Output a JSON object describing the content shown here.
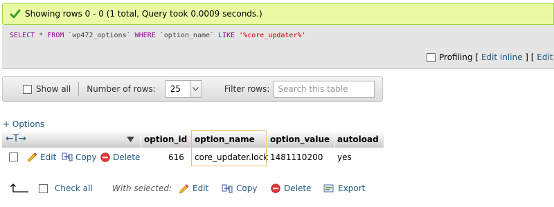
{
  "message": {
    "text": "Showing rows 0 - 0 (1 total, Query took 0.0009 seconds.)"
  },
  "sql": {
    "select": "SELECT",
    "star": " * ",
    "from": "FROM",
    "table": " `wp472_options` ",
    "where": "WHERE",
    "column": " `option_name` ",
    "like": "LIKE",
    "pattern": " '%core_updater%'",
    "profiling_label": "Profiling",
    "bracket_open": " [ ",
    "edit_inline": "Edit inline",
    "bracket_mid": " ] [ ",
    "edit": "Edit",
    "bracket_tail": " ] ["
  },
  "nav": {
    "show_all": "Show all",
    "number_of_rows_label": "Number of rows:",
    "rows_value": "25",
    "filter_label": "Filter rows:",
    "filter_placeholder": "Search this table"
  },
  "options_link": "+ Options",
  "table": {
    "arrows": "←T→",
    "columns": [
      "option_id",
      "option_name",
      "option_value",
      "autoload"
    ],
    "row": {
      "edit": "Edit",
      "copy": "Copy",
      "delete": "Delete",
      "option_id": "616",
      "option_name": "core_updater.lock",
      "option_value": "1481110200",
      "autoload": "yes"
    }
  },
  "bottom": {
    "check_all": "Check all",
    "with_selected": "With selected:",
    "edit": "Edit",
    "copy": "Copy",
    "delete": "Delete",
    "export": "Export"
  },
  "colors": {
    "success_bg": "#ebf8a4",
    "link": "#235a81",
    "sql_keyword": "#990099",
    "sql_string": "#cc0000",
    "highlight_border": "#f0b96e"
  },
  "icons": [
    "check-icon",
    "sort-down-icon",
    "pencil-icon",
    "copy-icon",
    "delete-icon",
    "arrow-up-left-icon",
    "export-icon",
    "dropdown-arrow-icon"
  ]
}
